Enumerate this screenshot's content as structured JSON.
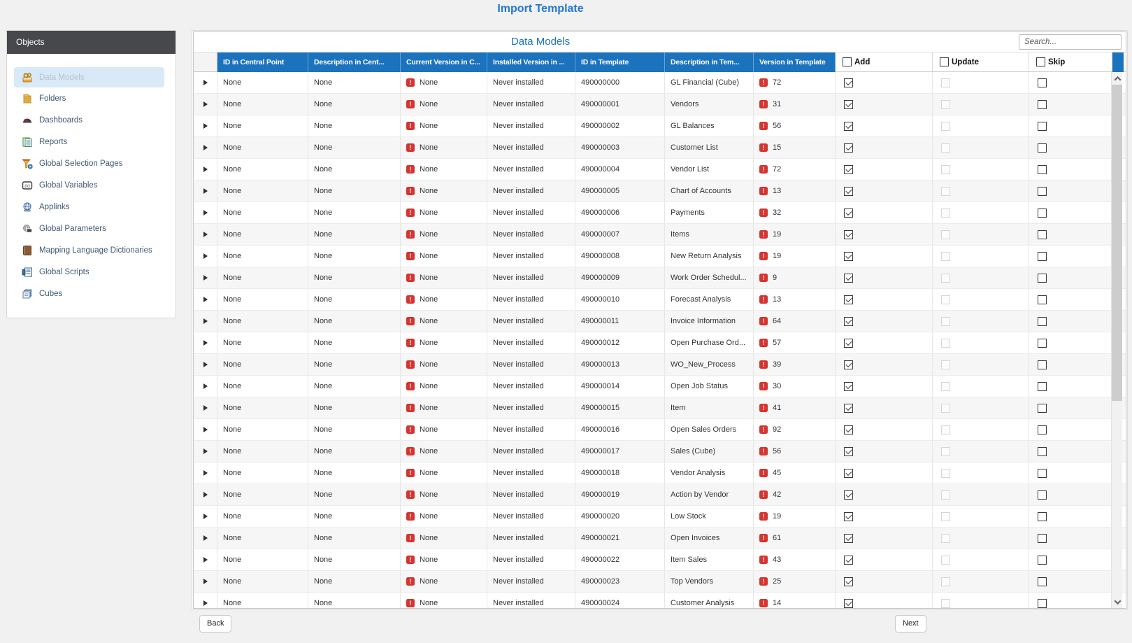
{
  "page": {
    "title": "Import Template"
  },
  "sidebar": {
    "header": "Objects",
    "items": [
      {
        "label": "Data Models",
        "icon": "data-models-icon",
        "selected": true
      },
      {
        "label": "Folders",
        "icon": "folders-icon",
        "selected": false
      },
      {
        "label": "Dashboards",
        "icon": "dashboards-icon",
        "selected": false
      },
      {
        "label": "Reports",
        "icon": "reports-icon",
        "selected": false
      },
      {
        "label": "Global Selection Pages",
        "icon": "global-selection-pages-icon",
        "selected": false
      },
      {
        "label": "Global Variables",
        "icon": "global-variables-icon",
        "selected": false
      },
      {
        "label": "Applinks",
        "icon": "applinks-icon",
        "selected": false
      },
      {
        "label": "Global Parameters",
        "icon": "global-parameters-icon",
        "selected": false
      },
      {
        "label": "Mapping Language Dictionaries",
        "icon": "mapping-language-dictionaries-icon",
        "selected": false
      },
      {
        "label": "Global Scripts",
        "icon": "global-scripts-icon",
        "selected": false
      },
      {
        "label": "Cubes",
        "icon": "cubes-icon",
        "selected": false
      }
    ]
  },
  "table": {
    "title": "Data Models",
    "search_placeholder": "Search...",
    "columns": [
      "ID in Central Point",
      "Description in Cent...",
      "Current Version in C...",
      "Installed Version in ...",
      "ID in Template",
      "Description in Tem...",
      "Version in Template"
    ],
    "action_columns": [
      "Add",
      "Update",
      "Skip"
    ],
    "rows": [
      {
        "id_central": "None",
        "desc_central": "None",
        "current_version": "None",
        "installed": "Never installed",
        "id_template": "490000000",
        "desc_template": "GL Financial (Cube)",
        "version": "72",
        "add": true,
        "update": false,
        "skip": false
      },
      {
        "id_central": "None",
        "desc_central": "None",
        "current_version": "None",
        "installed": "Never installed",
        "id_template": "490000001",
        "desc_template": "Vendors",
        "version": "31",
        "add": true,
        "update": false,
        "skip": false
      },
      {
        "id_central": "None",
        "desc_central": "None",
        "current_version": "None",
        "installed": "Never installed",
        "id_template": "490000002",
        "desc_template": "GL Balances",
        "version": "56",
        "add": true,
        "update": false,
        "skip": false
      },
      {
        "id_central": "None",
        "desc_central": "None",
        "current_version": "None",
        "installed": "Never installed",
        "id_template": "490000003",
        "desc_template": "Customer List",
        "version": "15",
        "add": true,
        "update": false,
        "skip": false
      },
      {
        "id_central": "None",
        "desc_central": "None",
        "current_version": "None",
        "installed": "Never installed",
        "id_template": "490000004",
        "desc_template": "Vendor List",
        "version": "72",
        "add": true,
        "update": false,
        "skip": false
      },
      {
        "id_central": "None",
        "desc_central": "None",
        "current_version": "None",
        "installed": "Never installed",
        "id_template": "490000005",
        "desc_template": "Chart of Accounts",
        "version": "13",
        "add": true,
        "update": false,
        "skip": false
      },
      {
        "id_central": "None",
        "desc_central": "None",
        "current_version": "None",
        "installed": "Never installed",
        "id_template": "490000006",
        "desc_template": "Payments",
        "version": "32",
        "add": true,
        "update": false,
        "skip": false
      },
      {
        "id_central": "None",
        "desc_central": "None",
        "current_version": "None",
        "installed": "Never installed",
        "id_template": "490000007",
        "desc_template": "Items",
        "version": "19",
        "add": true,
        "update": false,
        "skip": false
      },
      {
        "id_central": "None",
        "desc_central": "None",
        "current_version": "None",
        "installed": "Never installed",
        "id_template": "490000008",
        "desc_template": "New Return Analysis",
        "version": "19",
        "add": true,
        "update": false,
        "skip": false
      },
      {
        "id_central": "None",
        "desc_central": "None",
        "current_version": "None",
        "installed": "Never installed",
        "id_template": "490000009",
        "desc_template": "Work Order Schedul...",
        "version": "9",
        "add": true,
        "update": false,
        "skip": false
      },
      {
        "id_central": "None",
        "desc_central": "None",
        "current_version": "None",
        "installed": "Never installed",
        "id_template": "490000010",
        "desc_template": "Forecast Analysis",
        "version": "13",
        "add": true,
        "update": false,
        "skip": false
      },
      {
        "id_central": "None",
        "desc_central": "None",
        "current_version": "None",
        "installed": "Never installed",
        "id_template": "490000011",
        "desc_template": "Invoice Information",
        "version": "64",
        "add": true,
        "update": false,
        "skip": false
      },
      {
        "id_central": "None",
        "desc_central": "None",
        "current_version": "None",
        "installed": "Never installed",
        "id_template": "490000012",
        "desc_template": "Open Purchase Ord...",
        "version": "57",
        "add": true,
        "update": false,
        "skip": false
      },
      {
        "id_central": "None",
        "desc_central": "None",
        "current_version": "None",
        "installed": "Never installed",
        "id_template": "490000013",
        "desc_template": "WO_New_Process",
        "version": "39",
        "add": true,
        "update": false,
        "skip": false
      },
      {
        "id_central": "None",
        "desc_central": "None",
        "current_version": "None",
        "installed": "Never installed",
        "id_template": "490000014",
        "desc_template": "Open Job Status",
        "version": "30",
        "add": true,
        "update": false,
        "skip": false
      },
      {
        "id_central": "None",
        "desc_central": "None",
        "current_version": "None",
        "installed": "Never installed",
        "id_template": "490000015",
        "desc_template": "Item",
        "version": "41",
        "add": true,
        "update": false,
        "skip": false
      },
      {
        "id_central": "None",
        "desc_central": "None",
        "current_version": "None",
        "installed": "Never installed",
        "id_template": "490000016",
        "desc_template": "Open Sales Orders",
        "version": "92",
        "add": true,
        "update": false,
        "skip": false
      },
      {
        "id_central": "None",
        "desc_central": "None",
        "current_version": "None",
        "installed": "Never installed",
        "id_template": "490000017",
        "desc_template": "Sales (Cube)",
        "version": "56",
        "add": true,
        "update": false,
        "skip": false
      },
      {
        "id_central": "None",
        "desc_central": "None",
        "current_version": "None",
        "installed": "Never installed",
        "id_template": "490000018",
        "desc_template": "Vendor Analysis",
        "version": "45",
        "add": true,
        "update": false,
        "skip": false
      },
      {
        "id_central": "None",
        "desc_central": "None",
        "current_version": "None",
        "installed": "Never installed",
        "id_template": "490000019",
        "desc_template": "Action by Vendor",
        "version": "42",
        "add": true,
        "update": false,
        "skip": false
      },
      {
        "id_central": "None",
        "desc_central": "None",
        "current_version": "None",
        "installed": "Never installed",
        "id_template": "490000020",
        "desc_template": "Low Stock",
        "version": "19",
        "add": true,
        "update": false,
        "skip": false
      },
      {
        "id_central": "None",
        "desc_central": "None",
        "current_version": "None",
        "installed": "Never installed",
        "id_template": "490000021",
        "desc_template": "Open Invoices",
        "version": "61",
        "add": true,
        "update": false,
        "skip": false
      },
      {
        "id_central": "None",
        "desc_central": "None",
        "current_version": "None",
        "installed": "Never installed",
        "id_template": "490000022",
        "desc_template": "Item Sales",
        "version": "43",
        "add": true,
        "update": false,
        "skip": false
      },
      {
        "id_central": "None",
        "desc_central": "None",
        "current_version": "None",
        "installed": "Never installed",
        "id_template": "490000023",
        "desc_template": "Top Vendors",
        "version": "25",
        "add": true,
        "update": false,
        "skip": false
      },
      {
        "id_central": "None",
        "desc_central": "None",
        "current_version": "None",
        "installed": "Never installed",
        "id_template": "490000024",
        "desc_template": "Customer Analysis",
        "version": "14",
        "add": true,
        "update": false,
        "skip": false
      }
    ]
  },
  "footer": {
    "back": "Back",
    "next": "Next"
  },
  "colors": {
    "header_blue": "#1b72bd",
    "panel_title_blue": "#1a73bd",
    "page_title_blue": "#2277d4",
    "sidebar_header_bg": "#47484c",
    "selected_item_bg": "#d8eaf7",
    "badge_red": "#d5342f",
    "row_alt_bg": "#f6f6f7"
  }
}
